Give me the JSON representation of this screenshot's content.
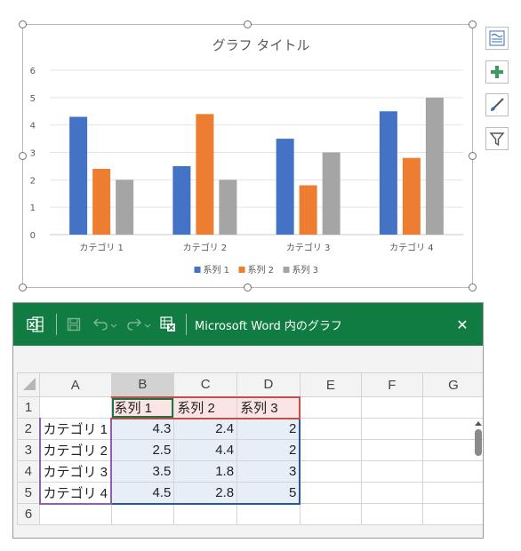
{
  "chart_data": {
    "type": "bar",
    "title": "グラフ タイトル",
    "categories": [
      "カテゴリ 1",
      "カテゴリ 2",
      "カテゴリ 3",
      "カテゴリ 4"
    ],
    "series": [
      {
        "name": "系列 1",
        "values": [
          4.3,
          2.5,
          3.5,
          4.5
        ],
        "color": "#4472c4"
      },
      {
        "name": "系列 2",
        "values": [
          2.4,
          4.4,
          1.8,
          2.8
        ],
        "color": "#ed7d31"
      },
      {
        "name": "系列 3",
        "values": [
          2,
          2,
          3,
          5
        ],
        "color": "#a5a5a5"
      }
    ],
    "ylim": [
      0,
      6
    ],
    "yticks": [
      "0",
      "1",
      "2",
      "3",
      "4",
      "5",
      "6"
    ],
    "grid": true,
    "legend": "bottom"
  },
  "chart_side_buttons": [
    {
      "icon": "chart-elements-icon"
    },
    {
      "icon": "plus-icon"
    },
    {
      "icon": "brush-icon"
    },
    {
      "icon": "filter-icon"
    }
  ],
  "excel": {
    "title": "Microsoft Word 内のグラフ",
    "close": "✕",
    "columns": [
      "A",
      "B",
      "C",
      "D",
      "E",
      "F",
      "G"
    ],
    "rows": [
      {
        "num": "1",
        "cells": [
          "",
          "系列 1",
          "系列 2",
          "系列 3",
          "",
          "",
          ""
        ]
      },
      {
        "num": "2",
        "cells": [
          "カテゴリ 1",
          "4.3",
          "2.4",
          "2",
          "",
          "",
          ""
        ]
      },
      {
        "num": "3",
        "cells": [
          "カテゴリ 2",
          "2.5",
          "4.4",
          "2",
          "",
          "",
          ""
        ]
      },
      {
        "num": "4",
        "cells": [
          "カテゴリ 3",
          "3.5",
          "1.8",
          "3",
          "",
          "",
          ""
        ]
      },
      {
        "num": "5",
        "cells": [
          "カテゴリ 4",
          "4.5",
          "2.8",
          "5",
          "",
          "",
          ""
        ]
      },
      {
        "num": "6",
        "cells": [
          "",
          "",
          "",
          "",
          "",
          "",
          ""
        ]
      }
    ]
  },
  "colors": {
    "excel_green": "#107c41",
    "accent_blue": "#4472c4",
    "accent_orange": "#ed7d31",
    "accent_gray": "#a5a5a5"
  }
}
